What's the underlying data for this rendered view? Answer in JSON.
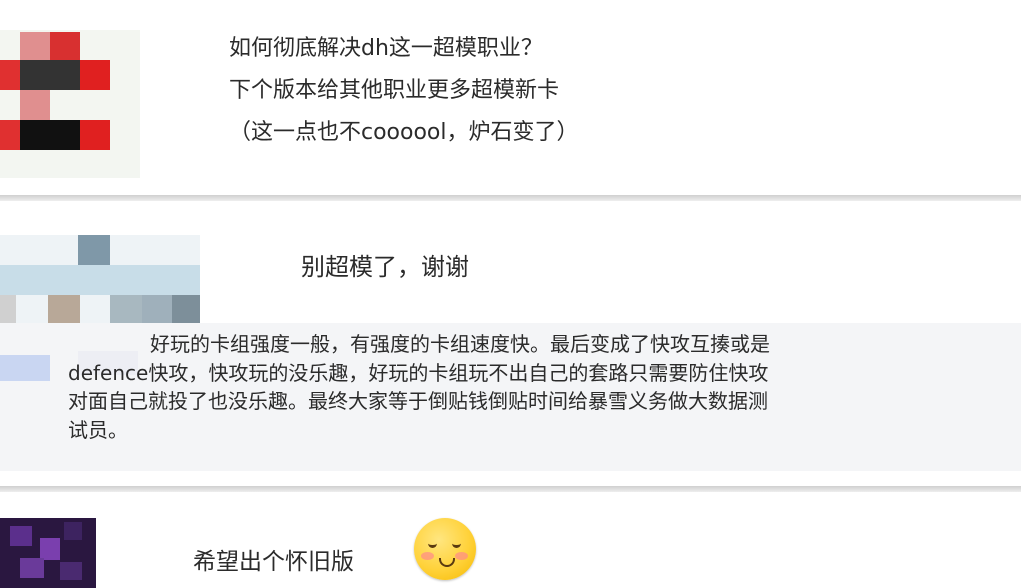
{
  "comments": [
    {
      "lines": [
        "如何彻底解决dh这一超模职业？",
        "下个版本给其他职业更多超模新卡",
        "（这一点也不coooool，炉石变了）"
      ]
    },
    {
      "lines": [
        "别超模了，谢谢"
      ]
    },
    {
      "quote_lines": [
        "好玩的卡组强度一般，有强度的卡组速度快。最后变成了快攻互揍或是",
        "defence快攻，快攻玩的没乐趣，好玩的卡组玩不出自己的套路只需要防住快攻",
        "对面自己就投了也没乐趣。最终大家等于倒贴钱倒贴时间给暴雪义务做大数据测",
        "试员。"
      ]
    },
    {
      "lines": [
        "希望出个怀旧版"
      ],
      "emoji": "blushing-smile-icon"
    }
  ],
  "colors": {
    "background": "#ffffff",
    "quote_background": "#f4f5f7",
    "text": "#2b2b2b",
    "divider": "#cfcfcf"
  }
}
